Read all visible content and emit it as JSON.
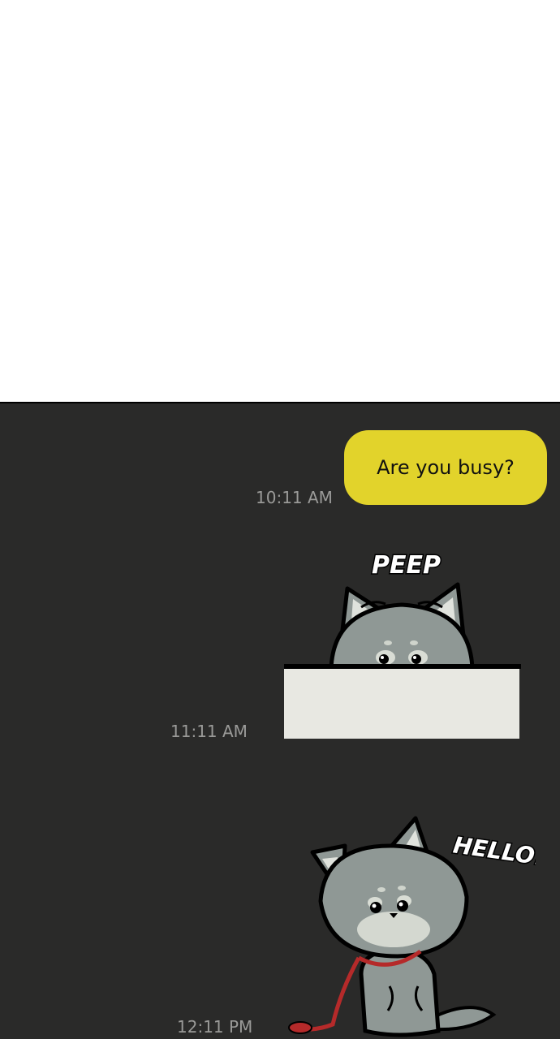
{
  "messages": [
    {
      "text": "Are you busy?",
      "time": "10:11 AM"
    },
    {
      "sticker": "peeking-wolf-sticker",
      "sfx": "PEEP",
      "time": "11:11 AM"
    },
    {
      "sticker": "waving-wolf-sticker",
      "sfx": "HELLO!",
      "time": "12:11 PM"
    }
  ],
  "colors": {
    "chat_background": "#2a2a29",
    "bubble": "#e2d32b",
    "timestamp": "#9a9a98",
    "wolf_fur": "#8f9895",
    "leash": "#b52a2a"
  }
}
